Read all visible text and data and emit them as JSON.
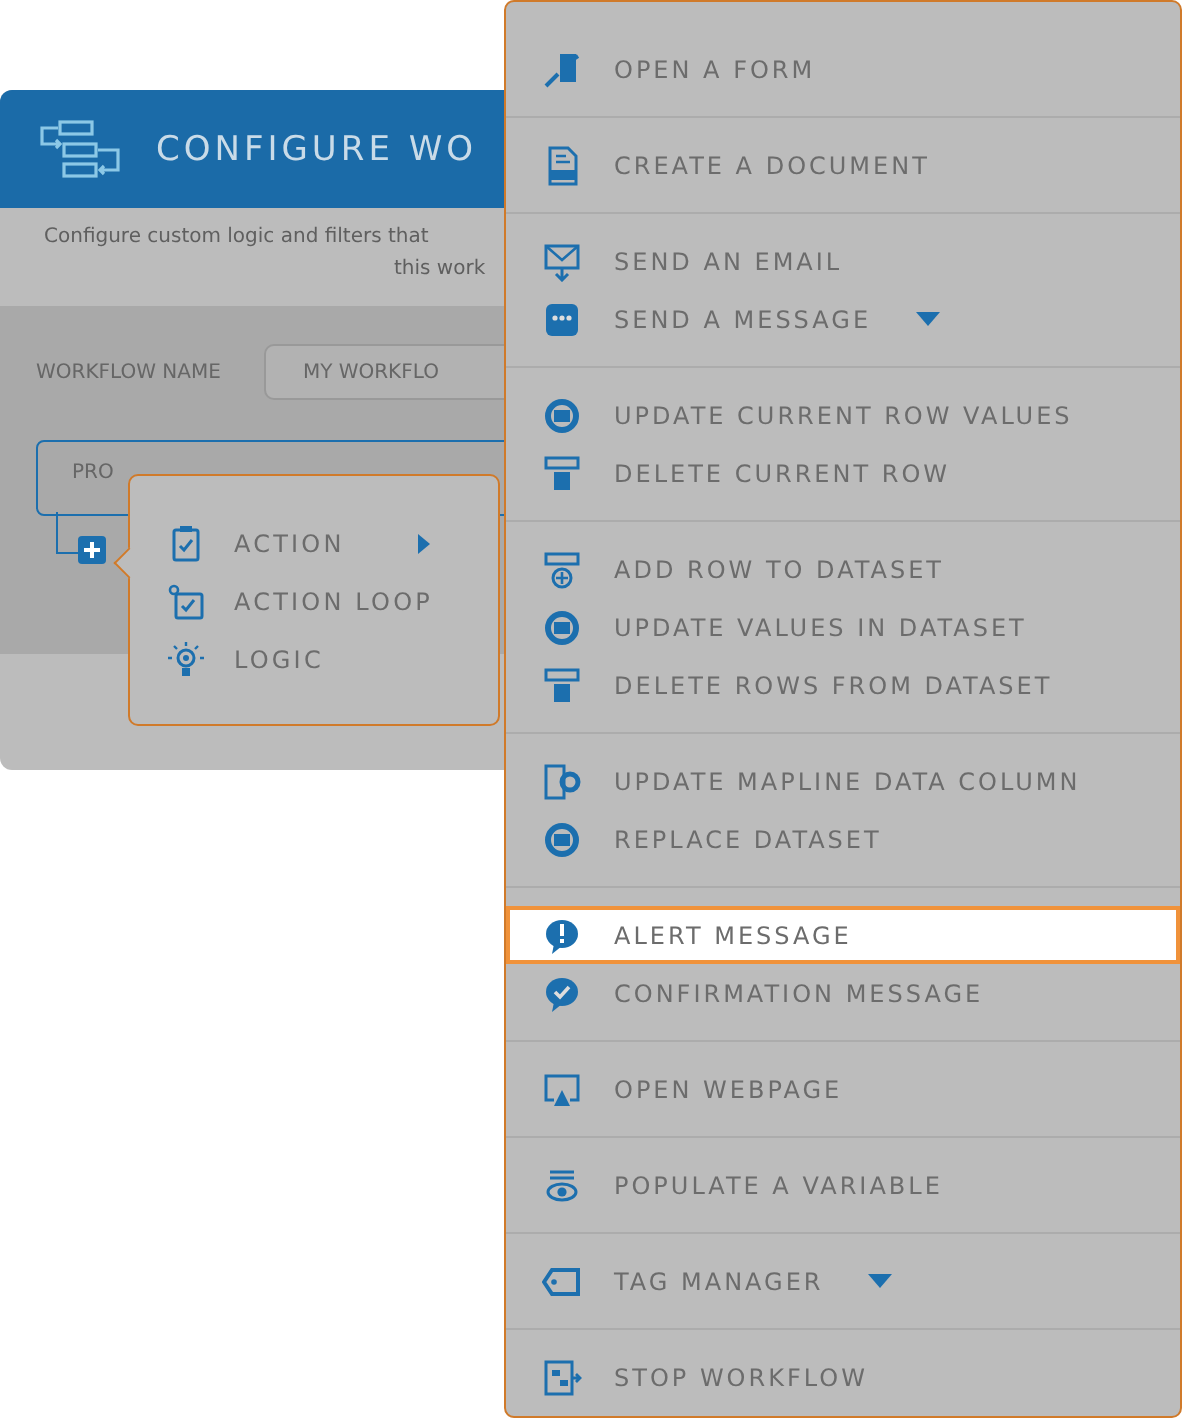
{
  "dialog": {
    "title": "CONFIGURE WO",
    "description_lines": [
      "Configure custom logic and filters that",
      "this work"
    ],
    "workflow_name_label": "WORKFLOW NAME",
    "workflow_name_value": "MY WORKFLO",
    "process_block": "PRO"
  },
  "submenu": {
    "items": [
      {
        "label": "ACTION",
        "has_submenu": true
      },
      {
        "label": "ACTION LOOP",
        "has_submenu": false
      },
      {
        "label": "LOGIC",
        "has_submenu": false
      }
    ]
  },
  "menu": {
    "groups": [
      {
        "items": [
          {
            "label": "OPEN A FORM",
            "dropdown": false,
            "selected": false
          }
        ]
      },
      {
        "items": [
          {
            "label": "CREATE A DOCUMENT",
            "dropdown": false,
            "selected": false
          }
        ]
      },
      {
        "items": [
          {
            "label": "SEND AN EMAIL",
            "dropdown": false,
            "selected": false
          },
          {
            "label": "SEND A MESSAGE",
            "dropdown": true,
            "selected": false
          }
        ]
      },
      {
        "items": [
          {
            "label": "UPDATE CURRENT ROW VALUES",
            "dropdown": false,
            "selected": false
          },
          {
            "label": "DELETE CURRENT ROW",
            "dropdown": false,
            "selected": false
          }
        ]
      },
      {
        "items": [
          {
            "label": "ADD ROW TO DATASET",
            "dropdown": false,
            "selected": false
          },
          {
            "label": "UPDATE VALUES IN DATASET",
            "dropdown": false,
            "selected": false
          },
          {
            "label": "DELETE ROWS FROM DATASET",
            "dropdown": false,
            "selected": false
          }
        ]
      },
      {
        "items": [
          {
            "label": "UPDATE MAPLINE DATA COLUMN",
            "dropdown": false,
            "selected": false
          },
          {
            "label": "REPLACE DATASET",
            "dropdown": false,
            "selected": false
          }
        ]
      },
      {
        "items": [
          {
            "label": "ALERT MESSAGE",
            "dropdown": false,
            "selected": true
          },
          {
            "label": "CONFIRMATION MESSAGE",
            "dropdown": false,
            "selected": false
          }
        ]
      },
      {
        "items": [
          {
            "label": "OPEN WEBPAGE",
            "dropdown": false,
            "selected": false
          }
        ]
      },
      {
        "items": [
          {
            "label": "POPULATE A VARIABLE",
            "dropdown": false,
            "selected": false
          }
        ]
      },
      {
        "items": [
          {
            "label": "TAG MANAGER",
            "dropdown": true,
            "selected": false
          }
        ]
      },
      {
        "items": [
          {
            "label": "STOP WORKFLOW",
            "dropdown": false,
            "selected": false
          }
        ]
      }
    ]
  }
}
